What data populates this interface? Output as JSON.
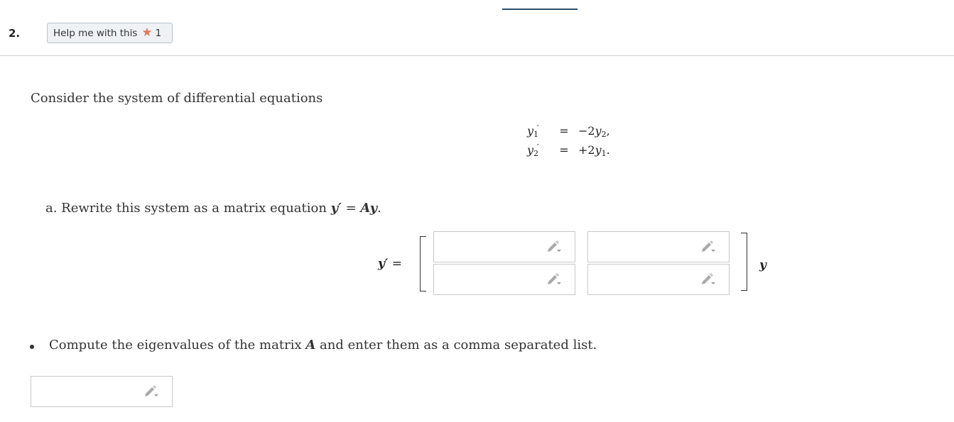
{
  "question": {
    "number": "2."
  },
  "help_button": {
    "label": "Help me with this",
    "count": "1",
    "icon": "star-icon",
    "star_color": "#e4775a"
  },
  "intro_text": "Consider the system of differential equations",
  "system": {
    "row1": {
      "lhs_var": "y",
      "lhs_sub": "1",
      "lhs_prime": "′",
      "op": "=",
      "rhs_coef": "−2",
      "rhs_var": "y",
      "rhs_sub": "2",
      "rhs_tail": ","
    },
    "row2": {
      "lhs_var": "y",
      "lhs_sub": "2",
      "lhs_prime": "′",
      "op": "=",
      "rhs_coef": "+2",
      "rhs_var": "y",
      "rhs_sub": "1",
      "rhs_tail": "."
    }
  },
  "part_a": {
    "prefix": "a. Rewrite this system as a matrix equation ",
    "lhs": "y′",
    "eq": " = ",
    "rhs": "Ay",
    "tail": "."
  },
  "matrix_eq": {
    "lhs": "y′",
    "eq": " =",
    "rhs": "y"
  },
  "matrix_inputs": {
    "r1c1": "",
    "r1c2": "",
    "r2c1": "",
    "r2c2": ""
  },
  "part_b": {
    "prefix": "Compute the eigenvalues of the matrix ",
    "var": "A",
    "suffix": " and enter them as a comma separated list."
  },
  "eigen_input": {
    "value": ""
  },
  "icons": {
    "pencil": "pencil-icon"
  }
}
